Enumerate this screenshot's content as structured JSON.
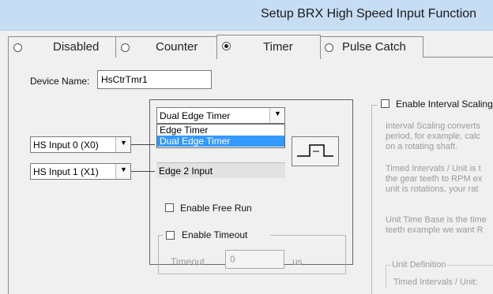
{
  "window": {
    "title": "Setup BRX High Speed Input Function"
  },
  "mode_tabs": [
    {
      "label": "Disabled",
      "selected": false
    },
    {
      "label": "Counter",
      "selected": false
    },
    {
      "label": "Timer",
      "selected": true
    },
    {
      "label": "Pulse Catch",
      "selected": false
    }
  ],
  "device": {
    "label": "Device Name:",
    "value": "HsCtrTmr1"
  },
  "inputs": {
    "input0": "HS Input 0 (X0)",
    "input1": "HS Input 1 (X1)"
  },
  "timer_type": {
    "value": "Dual Edge Timer",
    "options": [
      "Edge Timer",
      "Dual Edge Timer"
    ],
    "highlighted": "Dual Edge Timer"
  },
  "edge2": {
    "label": "Edge 2 Input"
  },
  "free_run": {
    "label": "Enable Free Run",
    "checked": false
  },
  "timeout": {
    "label": "Enable Timeout",
    "checked": false,
    "field_label": "Timeout",
    "value": "0",
    "unit": "us"
  },
  "interval_scaling": {
    "label": "Enable Interval Scaling",
    "checked": false,
    "desc1": [
      "Interval Scaling converts",
      "period, for example, calc",
      "on a rotating shaft."
    ],
    "desc2": [
      "Timed Intervals / Unit is t",
      "the gear teeth to RPM ex",
      "unit is rotations, your rat"
    ],
    "desc3": [
      "Unit Time Base is the time",
      "teeth example we want R"
    ],
    "unit_definition": "Unit Definition",
    "timed_intervals_label": "Timed Intervals / Unit:"
  },
  "icons": {
    "radio": "radio-button",
    "dropdown": "chevron-down-icon",
    "waveform": "pulse-waveform-icon"
  }
}
